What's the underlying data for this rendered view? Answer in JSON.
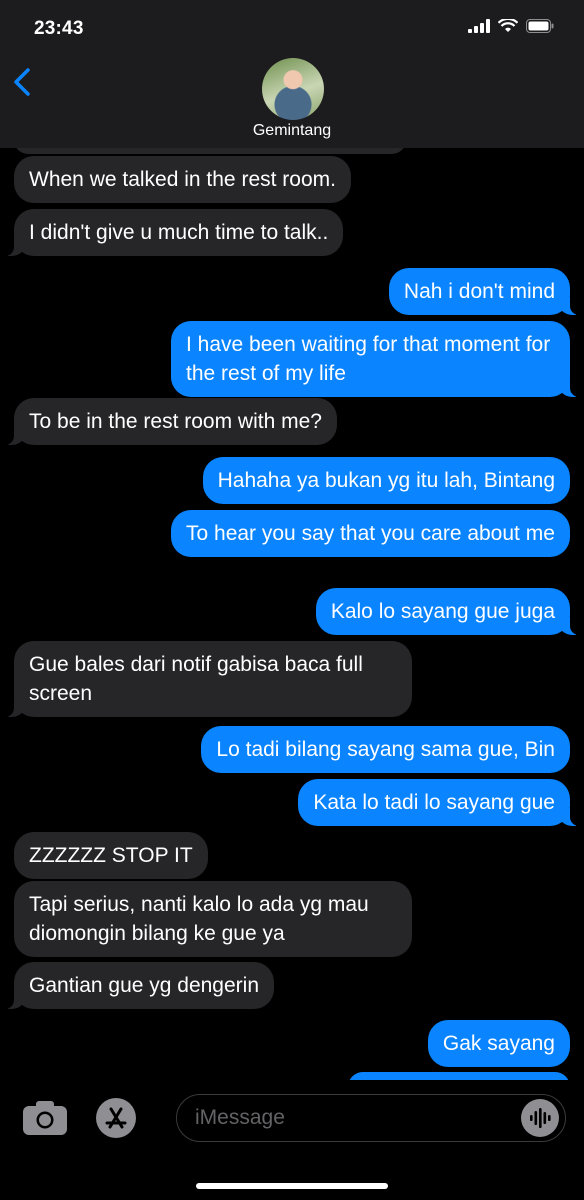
{
  "status": {
    "time": "23:43"
  },
  "header": {
    "contact_name": "Gemintang"
  },
  "messages": [
    {
      "from": "them",
      "text": "When we talked in the rest room."
    },
    {
      "from": "them",
      "text": "I didn't give u much time to talk.."
    },
    {
      "from": "me",
      "text": "Nah i don't mind"
    },
    {
      "from": "me",
      "text": "I have been waiting for that moment for the rest of my life"
    },
    {
      "from": "them",
      "text": "To be in the rest room with me?"
    },
    {
      "from": "me",
      "text": "Hahaha ya bukan yg itu lah, Bintang"
    },
    {
      "from": "me",
      "text": "To hear you say that you care about me"
    },
    {
      "from": "me",
      "text": "Kalo lo sayang gue juga"
    },
    {
      "from": "them",
      "text": "Gue bales dari notif gabisa baca full screen"
    },
    {
      "from": "me",
      "text": "Lo tadi bilang sayang sama gue, Bin"
    },
    {
      "from": "me",
      "text": "Kata lo tadi lo sayang gue"
    },
    {
      "from": "them",
      "text": "ZZZZZZ STOP IT"
    },
    {
      "from": "them",
      "text": "Tapi serius, nanti kalo lo ada yg mau diomongin bilang ke gue ya"
    },
    {
      "from": "them",
      "text": "Gantian gue yg dengerin"
    },
    {
      "from": "me",
      "text": "Gak sayang"
    }
  ],
  "composer": {
    "placeholder": "iMessage"
  },
  "icons": {
    "back": "chevron-left-icon",
    "camera": "camera-icon",
    "apps": "app-store-icon",
    "audio": "waveform-icon",
    "signal": "signal-icon",
    "wifi": "wifi-icon",
    "battery": "battery-icon"
  },
  "colors": {
    "outgoing": "#0a84ff",
    "incoming": "#262629",
    "accent": "#0a84ff"
  }
}
